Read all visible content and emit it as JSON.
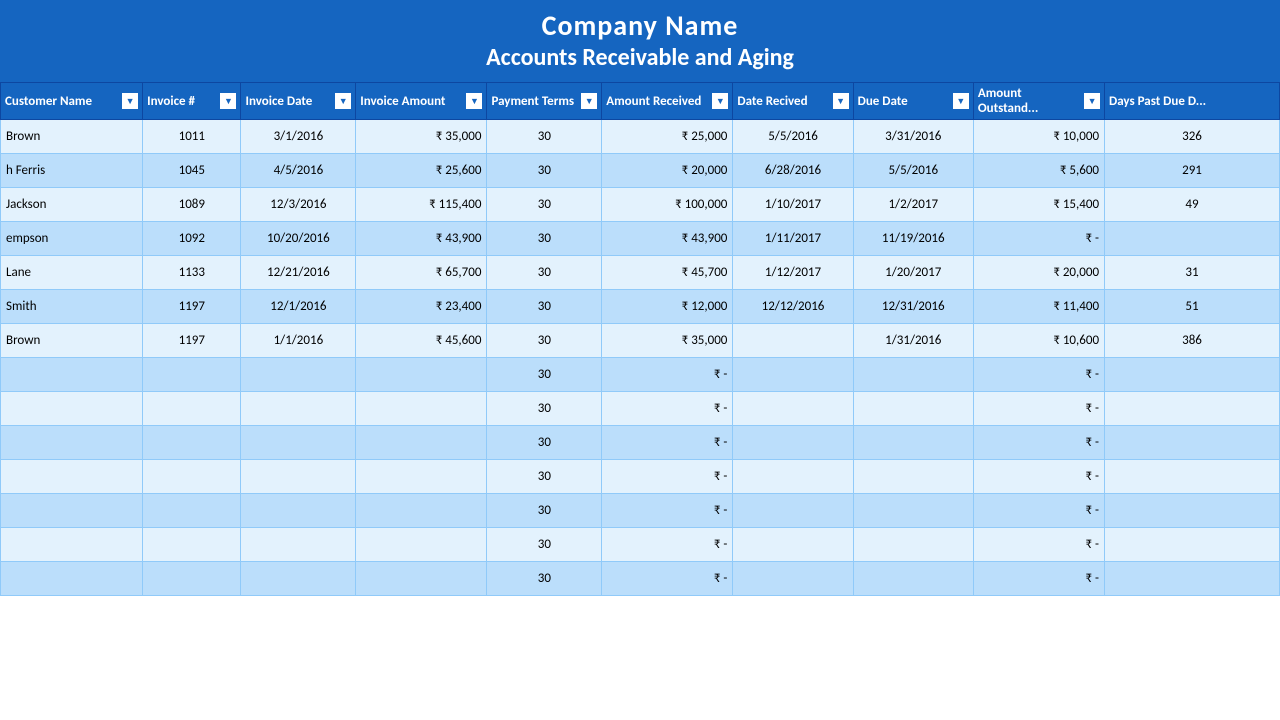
{
  "header": {
    "company_name": "Company Name",
    "subtitle": "Accounts Receivable and Aging"
  },
  "columns": [
    {
      "id": "customer",
      "label": "Customer Name",
      "has_dropdown": true
    },
    {
      "id": "invoice_num",
      "label": "Invoice #",
      "has_dropdown": true
    },
    {
      "id": "invoice_date",
      "label": "Invoice Date",
      "has_dropdown": true
    },
    {
      "id": "invoice_amount",
      "label": "Invoice Amount",
      "has_dropdown": true
    },
    {
      "id": "payment_terms",
      "label": "Payment Terms",
      "has_dropdown": true
    },
    {
      "id": "amount_received",
      "label": "Amount Received",
      "has_dropdown": true
    },
    {
      "id": "date_received",
      "label": "Date Recived",
      "has_dropdown": true
    },
    {
      "id": "due_date",
      "label": "Due Date",
      "has_dropdown": true
    },
    {
      "id": "amount_outstanding",
      "label": "Amount Outstand...",
      "has_dropdown": true
    },
    {
      "id": "days_past_due",
      "label": "Days Past Due D...",
      "has_dropdown": false
    }
  ],
  "rows": [
    {
      "customer": "Brown",
      "invoice_num": "1011",
      "invoice_date": "3/1/2016",
      "invoice_amount": "₹   35,000",
      "payment_terms": "30",
      "amount_received": "₹   25,000",
      "date_received": "5/5/2016",
      "due_date": "3/31/2016",
      "amount_outstanding": "₹  10,000",
      "days_past_due": "326"
    },
    {
      "customer": "h Ferris",
      "invoice_num": "1045",
      "invoice_date": "4/5/2016",
      "invoice_amount": "₹   25,600",
      "payment_terms": "30",
      "amount_received": "₹   20,000",
      "date_received": "6/28/2016",
      "due_date": "5/5/2016",
      "amount_outstanding": "₹   5,600",
      "days_past_due": "291"
    },
    {
      "customer": "Jackson",
      "invoice_num": "1089",
      "invoice_date": "12/3/2016",
      "invoice_amount": "₹ 115,400",
      "payment_terms": "30",
      "amount_received": "₹ 100,000",
      "date_received": "1/10/2017",
      "due_date": "1/2/2017",
      "amount_outstanding": "₹  15,400",
      "days_past_due": "49"
    },
    {
      "customer": "empson",
      "invoice_num": "1092",
      "invoice_date": "10/20/2016",
      "invoice_amount": "₹   43,900",
      "payment_terms": "30",
      "amount_received": "₹   43,900",
      "date_received": "1/11/2017",
      "due_date": "11/19/2016",
      "amount_outstanding": "₹        -",
      "days_past_due": ""
    },
    {
      "customer": "Lane",
      "invoice_num": "1133",
      "invoice_date": "12/21/2016",
      "invoice_amount": "₹   65,700",
      "payment_terms": "30",
      "amount_received": "₹   45,700",
      "date_received": "1/12/2017",
      "due_date": "1/20/2017",
      "amount_outstanding": "₹  20,000",
      "days_past_due": "31"
    },
    {
      "customer": "Smith",
      "invoice_num": "1197",
      "invoice_date": "12/1/2016",
      "invoice_amount": "₹   23,400",
      "payment_terms": "30",
      "amount_received": "₹   12,000",
      "date_received": "12/12/2016",
      "due_date": "12/31/2016",
      "amount_outstanding": "₹  11,400",
      "days_past_due": "51"
    },
    {
      "customer": "Brown",
      "invoice_num": "1197",
      "invoice_date": "1/1/2016",
      "invoice_amount": "₹   45,600",
      "payment_terms": "30",
      "amount_received": "₹   35,000",
      "date_received": "",
      "due_date": "1/31/2016",
      "amount_outstanding": "₹  10,600",
      "days_past_due": "386"
    },
    {
      "customer": "",
      "invoice_num": "",
      "invoice_date": "",
      "invoice_amount": "",
      "payment_terms": "30",
      "amount_received": "₹        -",
      "date_received": "",
      "due_date": "",
      "amount_outstanding": "₹        -",
      "days_past_due": ""
    },
    {
      "customer": "",
      "invoice_num": "",
      "invoice_date": "",
      "invoice_amount": "",
      "payment_terms": "30",
      "amount_received": "₹        -",
      "date_received": "",
      "due_date": "",
      "amount_outstanding": "₹        -",
      "days_past_due": ""
    },
    {
      "customer": "",
      "invoice_num": "",
      "invoice_date": "",
      "invoice_amount": "",
      "payment_terms": "30",
      "amount_received": "₹        -",
      "date_received": "",
      "due_date": "",
      "amount_outstanding": "₹        -",
      "days_past_due": ""
    },
    {
      "customer": "",
      "invoice_num": "",
      "invoice_date": "",
      "invoice_amount": "",
      "payment_terms": "30",
      "amount_received": "₹        -",
      "date_received": "",
      "due_date": "",
      "amount_outstanding": "₹        -",
      "days_past_due": ""
    },
    {
      "customer": "",
      "invoice_num": "",
      "invoice_date": "",
      "invoice_amount": "",
      "payment_terms": "30",
      "amount_received": "₹        -",
      "date_received": "",
      "due_date": "",
      "amount_outstanding": "₹        -",
      "days_past_due": ""
    },
    {
      "customer": "",
      "invoice_num": "",
      "invoice_date": "",
      "invoice_amount": "",
      "payment_terms": "30",
      "amount_received": "₹        -",
      "date_received": "",
      "due_date": "",
      "amount_outstanding": "₹        -",
      "days_past_due": ""
    },
    {
      "customer": "",
      "invoice_num": "",
      "invoice_date": "",
      "invoice_amount": "",
      "payment_terms": "30",
      "amount_received": "₹        -",
      "date_received": "",
      "due_date": "",
      "amount_outstanding": "₹        -",
      "days_past_due": ""
    }
  ]
}
